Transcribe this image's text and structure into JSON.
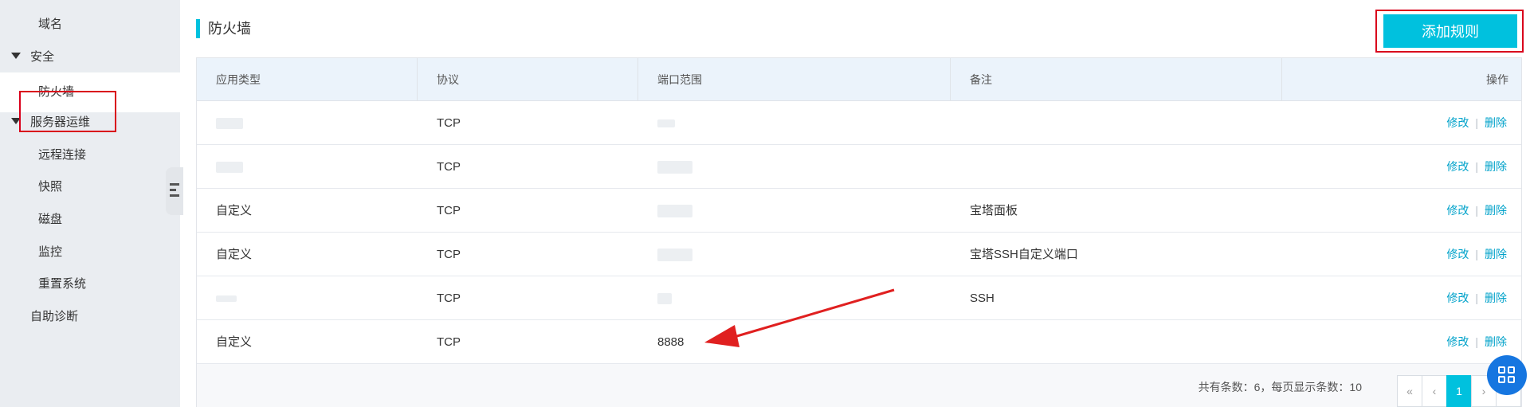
{
  "sidebar": {
    "items": [
      {
        "label": "域名"
      },
      {
        "label": "安全"
      },
      {
        "label": "防火墙"
      },
      {
        "label": "服务器运维"
      },
      {
        "label": "远程连接"
      },
      {
        "label": "快照"
      },
      {
        "label": "磁盘"
      },
      {
        "label": "监控"
      },
      {
        "label": "重置系统"
      },
      {
        "label": "自助诊断"
      }
    ]
  },
  "header": {
    "title": "防火墙",
    "add_button": "添加规则"
  },
  "table": {
    "headers": [
      "应用类型",
      "协议",
      "端口范围",
      "备注",
      "操作"
    ],
    "rows": [
      {
        "type": "",
        "protocol": "TCP",
        "port": "",
        "note": "",
        "edit": "修改",
        "sep": "|",
        "delete": "删除"
      },
      {
        "type": "",
        "protocol": "TCP",
        "port": "",
        "note": "",
        "edit": "修改",
        "sep": "|",
        "delete": "删除"
      },
      {
        "type": "自定义",
        "protocol": "TCP",
        "port": "",
        "note": "宝塔面板",
        "edit": "修改",
        "sep": "|",
        "delete": "删除"
      },
      {
        "type": "自定义",
        "protocol": "TCP",
        "port": "",
        "note": "宝塔SSH自定义端口",
        "edit": "修改",
        "sep": "|",
        "delete": "删除"
      },
      {
        "type": "",
        "protocol": "TCP",
        "port": "",
        "note": "SSH",
        "edit": "修改",
        "sep": "|",
        "delete": "删除"
      },
      {
        "type": "自定义",
        "protocol": "TCP",
        "port": "8888",
        "note": "",
        "edit": "修改",
        "sep": "|",
        "delete": "删除"
      }
    ]
  },
  "pagination": {
    "info": "共有条数：6，每页显示条数：10",
    "first": "«",
    "prev": "‹",
    "current": "1",
    "next": "›",
    "last": "»"
  },
  "colors": {
    "accent": "#00c1de",
    "link": "#00a2ca",
    "highlight_box": "#d9001b",
    "arrow": "#e02020",
    "float_button": "#1676e0"
  },
  "icons": {
    "caret": "caret-down-icon",
    "collapse": "collapse-menu-icon",
    "float": "grid-apps-icon"
  }
}
